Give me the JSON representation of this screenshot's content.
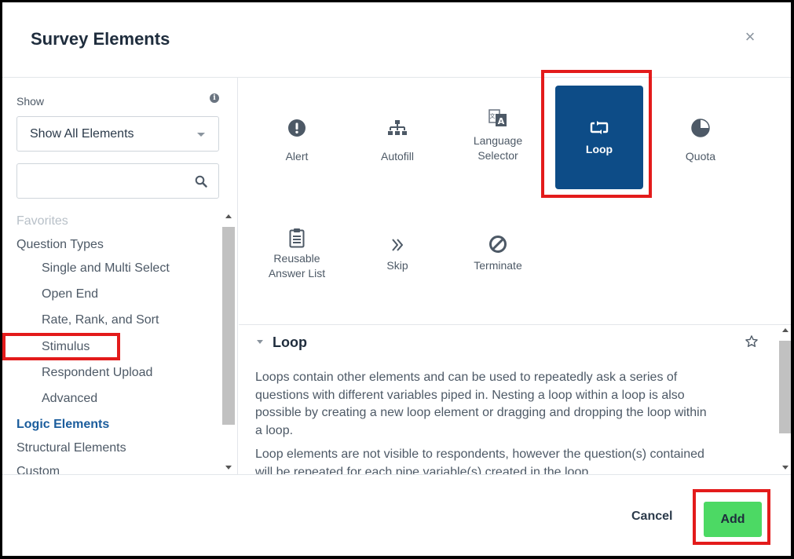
{
  "dialog": {
    "title": "Survey Elements",
    "close_symbol": "×"
  },
  "sidebar": {
    "show_label": "Show",
    "info_symbol": "i",
    "filter": {
      "value": "Show All Elements"
    },
    "search": {
      "placeholder": "",
      "value": ""
    },
    "nav": [
      {
        "label": "Favorites",
        "level": 0,
        "state": "faded"
      },
      {
        "label": "Question Types",
        "level": 0,
        "state": "normal"
      },
      {
        "label": "Single and Multi Select",
        "level": 1,
        "state": "normal"
      },
      {
        "label": "Open End",
        "level": 1,
        "state": "normal"
      },
      {
        "label": "Rate, Rank, and Sort",
        "level": 1,
        "state": "normal"
      },
      {
        "label": "Stimulus",
        "level": 1,
        "state": "normal"
      },
      {
        "label": "Respondent Upload",
        "level": 1,
        "state": "normal"
      },
      {
        "label": "Advanced",
        "level": 1,
        "state": "normal"
      },
      {
        "label": "Logic Elements",
        "level": 0,
        "state": "active"
      },
      {
        "label": "Structural Elements",
        "level": 0,
        "state": "normal"
      },
      {
        "label": "Custom",
        "level": 0,
        "state": "normal"
      }
    ]
  },
  "elements": [
    {
      "label": "Alert",
      "icon": "alert-icon"
    },
    {
      "label": "Autofill",
      "icon": "autofill-icon"
    },
    {
      "label": "Language\nSelector",
      "icon": "language-icon"
    },
    {
      "label": "Loop",
      "icon": "loop-icon",
      "selected": true
    },
    {
      "label": "Quota",
      "icon": "quota-icon"
    },
    {
      "label": "Reusable\nAnswer List",
      "icon": "clipboard-icon"
    },
    {
      "label": "Skip",
      "icon": "skip-icon"
    },
    {
      "label": "Terminate",
      "icon": "terminate-icon"
    }
  ],
  "detail": {
    "title": "Loop",
    "paragraphs": [
      "Loops contain other elements and can be used to repeatedly ask a series of questions with different variables piped in. Nesting a loop within a loop is also possible by creating a new loop element or dragging and dropping the loop within a loop.",
      "Loop elements are not visible to respondents, however the question(s) contained will be repeated for each pipe variable(s) created in the loop."
    ]
  },
  "footer": {
    "cancel_label": "Cancel",
    "add_label": "Add"
  },
  "colors": {
    "selected_tile": "#0d4c87",
    "add_button": "#4cd964",
    "highlight": "#e31b1b",
    "active_nav": "#1a5c9c"
  }
}
